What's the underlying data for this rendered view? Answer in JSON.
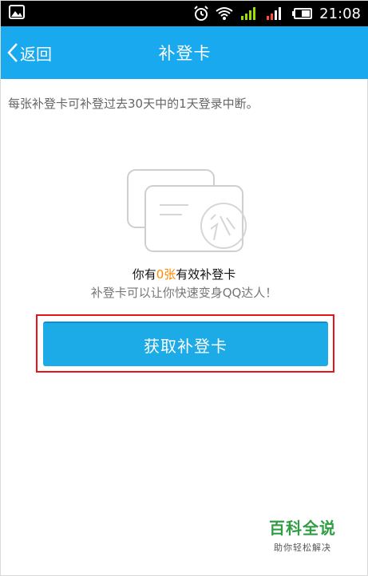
{
  "status_bar": {
    "time": "21:08",
    "icons": [
      "gallery-icon",
      "alarm-icon",
      "wifi-icon",
      "signal-icon",
      "signal-3g-icon",
      "battery-icon"
    ]
  },
  "header": {
    "back_label": "返回",
    "title": "补登卡",
    "background": "#19a9ee"
  },
  "main": {
    "description": "每张补登卡可补登过去30天中的1天登录中断。",
    "count_prefix": "你有",
    "count_value": "0张",
    "count_suffix": "有效补登卡",
    "subtitle": "补登卡可以让你快速变身QQ达人！",
    "get_button_label": "获取补登卡",
    "accent_color": "#ff8a00"
  },
  "watermark": {
    "title": "百科全说",
    "subtitle": "助你轻松解决"
  }
}
